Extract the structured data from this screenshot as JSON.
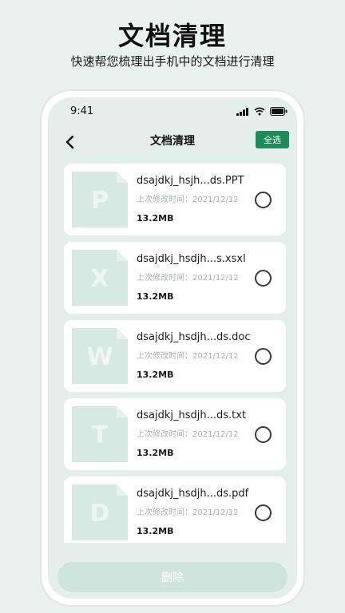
{
  "hero": {
    "title": "文档清理",
    "subtitle": "快速帮您梳理出手机中的文档进行清理"
  },
  "status_bar": {
    "time": "9:41",
    "icons": [
      "signal-icon",
      "wifi-icon",
      "battery-icon"
    ]
  },
  "nav": {
    "back_icon": "chevron-left-icon",
    "title": "文档清理",
    "select_all_label": "全选"
  },
  "files": [
    {
      "letter": "P",
      "name": "dsajdkj_hsjh...ds.PPT",
      "modified": "上次修改时间：2021/12/12",
      "size": "13.2MB",
      "selected": false
    },
    {
      "letter": "X",
      "name": "dsajdkj_hsdjh...s.xsxl",
      "modified": "上次修改时间：2021/12/12",
      "size": "13.2MB",
      "selected": false
    },
    {
      "letter": "W",
      "name": "dsajdkj_hsdjh...ds.doc",
      "modified": "上次修改时间：2021/12/12",
      "size": "13.2MB",
      "selected": false
    },
    {
      "letter": "T",
      "name": "dsajdkj_hsdjh...ds.txt",
      "modified": "上次修改时间：2021/12/12",
      "size": "13.2MB",
      "selected": false
    },
    {
      "letter": "D",
      "name": "dsajdkj_hsdjh...ds.pdf",
      "modified": "上次修改时间：2021/12/12",
      "size": "13.2MB",
      "selected": false
    }
  ],
  "footer": {
    "delete_label": "删除"
  },
  "colors": {
    "accent": "#1f8a5c",
    "page_bg": "#e9f2ef",
    "card_bg": "#ffffff",
    "thumb_bg": "#d8e9e3",
    "delete_disabled": "#cfe4dc"
  }
}
